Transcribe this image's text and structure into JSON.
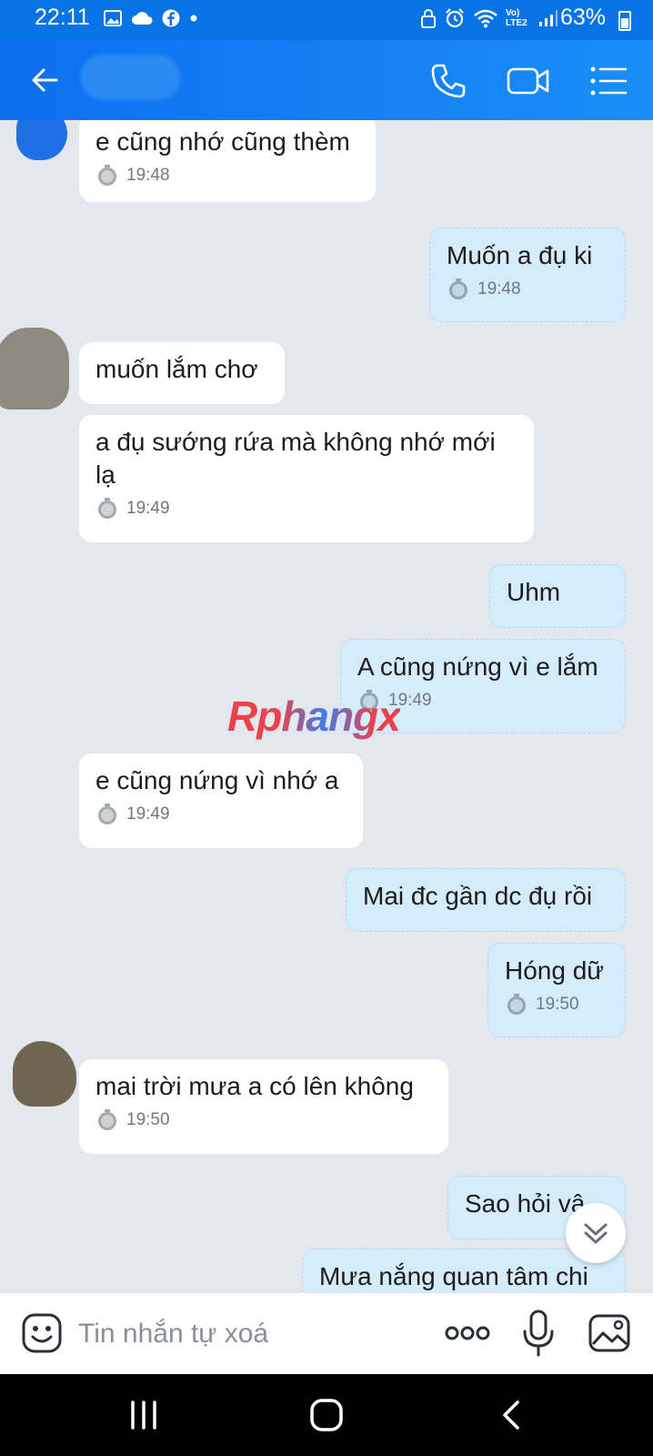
{
  "status_bar": {
    "time": "22:11",
    "battery": "63%",
    "network": "Vo) LTE2",
    "left_icons": [
      "gallery-icon",
      "cloud-icon",
      "facebook-icon",
      "dot-icon"
    ],
    "right_icons": [
      "vpn-lock-icon",
      "alarm-icon",
      "wifi-icon",
      "signal-icon",
      "battery-icon"
    ]
  },
  "header": {
    "contact_name": "",
    "icons": [
      "back-arrow-icon",
      "phone-icon",
      "video-call-icon",
      "menu-list-icon"
    ]
  },
  "messages": [
    {
      "side": "in",
      "text": "e cũng nhớ cũng thèm",
      "time": "19:48"
    },
    {
      "side": "out",
      "text": "Muốn a đụ ki",
      "time": "19:48"
    },
    {
      "side": "in",
      "text": "muốn lắm chơ",
      "time": ""
    },
    {
      "side": "in",
      "text": "a đụ sướng rứa mà không nhớ mới lạ",
      "time": "19:49"
    },
    {
      "side": "out",
      "text": "Uhm",
      "time": ""
    },
    {
      "side": "out",
      "text": "A cũng nứng vì e lắm",
      "time": "19:49"
    },
    {
      "side": "in",
      "text": "e cũng nứng vì nhớ a",
      "time": "19:49"
    },
    {
      "side": "out",
      "text": "Mai đc gần dc đụ rồi",
      "time": ""
    },
    {
      "side": "out",
      "text": "Hóng dữ",
      "time": "19:50"
    },
    {
      "side": "in",
      "text": "mai trời mưa a có lên không",
      "time": "19:50"
    },
    {
      "side": "out",
      "text": "Sao hỏi vậ",
      "time": ""
    },
    {
      "side": "out",
      "text": "Mưa nắng quan tâm chi",
      "time": ""
    }
  ],
  "watermark": "Rphangx",
  "composer": {
    "placeholder": "Tin nhắn tự xoá",
    "icons": [
      "sticker-icon",
      "more-options-icon",
      "microphone-icon",
      "image-icon"
    ]
  },
  "colors": {
    "header": "#0873e4",
    "incoming_bubble": "#ffffff",
    "outgoing_bubble": "#d4ecfb",
    "chat_background": "#e3e8ef"
  },
  "nav_bar": {
    "icons": [
      "recents-icon",
      "home-icon",
      "back-icon"
    ]
  }
}
